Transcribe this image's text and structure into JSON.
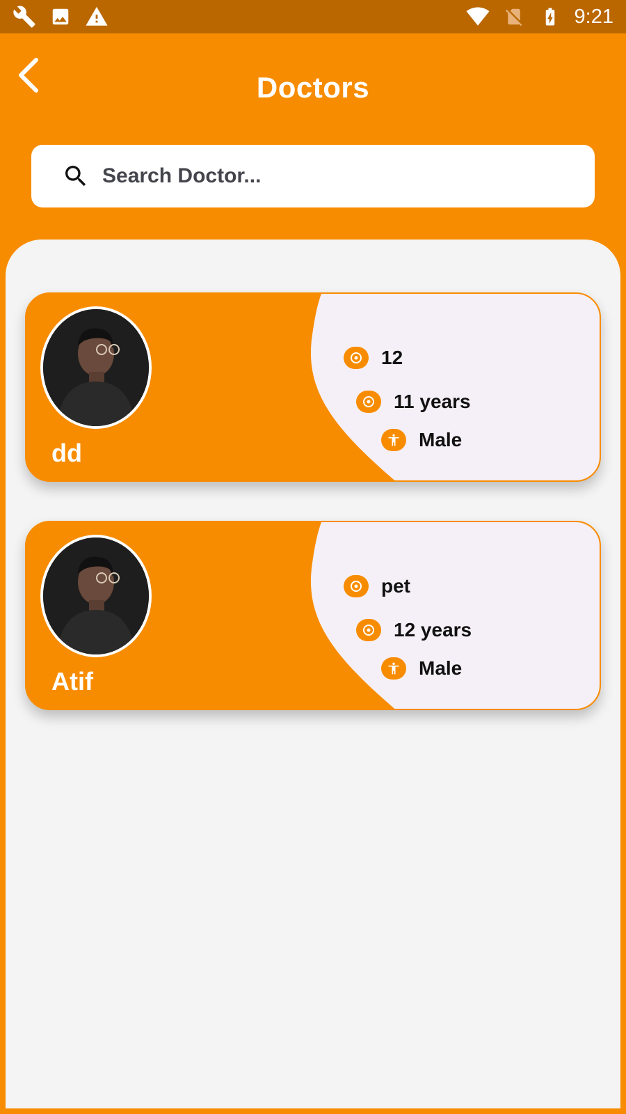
{
  "status_bar": {
    "time": "9:21",
    "left_icons": [
      "wrench-icon",
      "image-icon",
      "warning-icon"
    ],
    "right_icons": [
      "wifi-icon",
      "no-sim-icon",
      "battery-charging-icon"
    ]
  },
  "header": {
    "title": "Doctors",
    "back_icon": "chevron-left-icon"
  },
  "search": {
    "placeholder": "Search Doctor...",
    "value": ""
  },
  "doctors": [
    {
      "name": "dd",
      "specialty": "12",
      "experience": "11 years",
      "gender": "Male"
    },
    {
      "name": "Atif",
      "specialty": "pet",
      "experience": "12 years",
      "gender": "Male"
    }
  ],
  "colors": {
    "primary": "#F88C00",
    "status_bar": "#BA6700",
    "panel": "#F4F4F4",
    "card_right": "#F5F0F7"
  }
}
